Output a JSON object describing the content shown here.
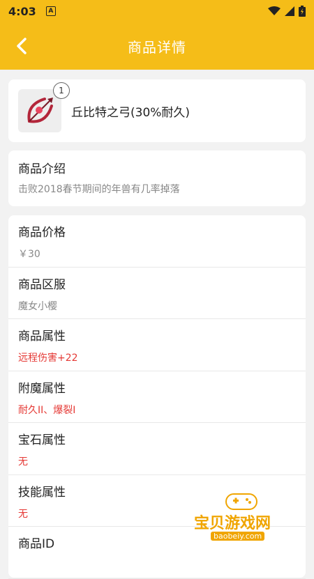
{
  "status_bar": {
    "time": "4:03",
    "notification_icon": "A"
  },
  "app_bar": {
    "title": "商品详情"
  },
  "item": {
    "name": "丘比特之弓(30%耐久)",
    "quantity": "1"
  },
  "intro": {
    "title": "商品介绍",
    "description": "击败2018春节期间的年兽有几率掉落"
  },
  "details": [
    {
      "label": "商品价格",
      "value": "￥30"
    },
    {
      "label": "商品区服",
      "value": "魔女小樱"
    },
    {
      "label": "商品属性",
      "value": "远程伤害+22"
    },
    {
      "label": "附魔属性",
      "value": "耐久II、爆裂I"
    },
    {
      "label": "宝石属性",
      "value": "无"
    },
    {
      "label": "技能属性",
      "value": "无"
    },
    {
      "label": "商品ID",
      "value": ""
    }
  ],
  "watermark": {
    "text": "宝贝游戏网",
    "url": "baobeiy.com"
  },
  "colors": {
    "accent": "#f5bd18",
    "red_value": "#e53935",
    "gray_value": "#888888"
  }
}
